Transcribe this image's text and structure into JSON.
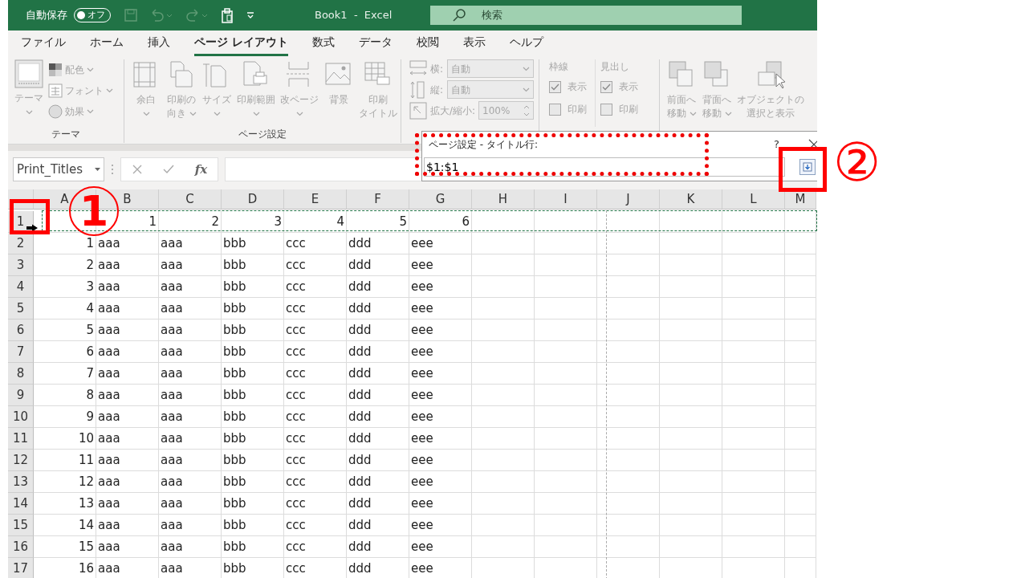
{
  "window": {
    "autosave": {
      "label": "自動保存",
      "toggle_text": "オフ",
      "on": false
    },
    "title": "Book1  -  Excel",
    "search": {
      "placeholder": "検索"
    }
  },
  "tabs": [
    {
      "label": "ファイル",
      "selected": false
    },
    {
      "label": "ホーム",
      "selected": false
    },
    {
      "label": "挿入",
      "selected": false
    },
    {
      "label": "ページ レイアウト",
      "selected": true
    },
    {
      "label": "数式",
      "selected": false
    },
    {
      "label": "データ",
      "selected": false
    },
    {
      "label": "校閲",
      "selected": false
    },
    {
      "label": "表示",
      "selected": false
    },
    {
      "label": "ヘルプ",
      "selected": false
    }
  ],
  "ribbon": {
    "disabled": true,
    "groups": [
      {
        "kind": "theme",
        "label": "テーマ",
        "big": "テーマ",
        "items": [
          "配色",
          "フォント",
          "効果"
        ]
      },
      {
        "kind": "buttons",
        "label": "ページ設定",
        "buttons": [
          {
            "lines": [
              "余白"
            ],
            "dropdown": true
          },
          {
            "lines": [
              "印刷の",
              "向き"
            ],
            "dropdown": true
          },
          {
            "lines": [
              "サイズ"
            ],
            "dropdown": true
          },
          {
            "lines": [
              "印刷範囲"
            ],
            "dropdown": true
          },
          {
            "lines": [
              "改ページ"
            ],
            "dropdown": true
          },
          {
            "lines": [
              "背景"
            ],
            "dropdown": false
          },
          {
            "lines": [
              "印刷",
              "タイトル"
            ],
            "dropdown": false
          }
        ]
      },
      {
        "kind": "scale",
        "rows": [
          {
            "label": "横:",
            "value": "自動",
            "kind": "dropdown"
          },
          {
            "label": "縦:",
            "value": "自動",
            "kind": "dropdown"
          },
          {
            "label": "拡大/縮小:",
            "value": "100%",
            "kind": "spin"
          }
        ]
      },
      {
        "kind": "sheet_options",
        "sections": [
          {
            "title": "枠線",
            "options": [
              {
                "label": "表示",
                "checked": true
              },
              {
                "label": "印刷",
                "checked": false
              }
            ]
          },
          {
            "title": "見出し",
            "options": [
              {
                "label": "表示",
                "checked": true
              },
              {
                "label": "印刷",
                "checked": false
              }
            ]
          }
        ]
      },
      {
        "kind": "buttons",
        "buttons": [
          {
            "lines": [
              "前面へ",
              "移動"
            ],
            "dropdown": true
          },
          {
            "lines": [
              "背面へ",
              "移動"
            ],
            "dropdown": true
          },
          {
            "lines": [
              "オブジェクトの",
              "選択と表示"
            ],
            "dropdown": false
          }
        ]
      }
    ]
  },
  "formula_bar": {
    "name_box": "Print_Titles",
    "fx": "fx"
  },
  "dialog": {
    "title": "ページ設定 - タイトル行:",
    "help": "?",
    "value": "$1:$1"
  },
  "sheet": {
    "columns": [
      "A",
      "B",
      "C",
      "D",
      "E",
      "F",
      "G",
      "H",
      "I",
      "J",
      "K",
      "L",
      "M"
    ],
    "rows": [
      {
        "header": "1",
        "kind": "numbers",
        "marquee": true,
        "cells": [
          "1",
          "2",
          "3",
          "4",
          "5",
          "6"
        ]
      },
      {
        "header": "2",
        "kind": "record",
        "cells": [
          "1",
          "aaa",
          "aaa",
          "bbb",
          "ccc",
          "ddd",
          "eee"
        ]
      },
      {
        "header": "3",
        "kind": "record",
        "cells": [
          "2",
          "aaa",
          "aaa",
          "bbb",
          "ccc",
          "ddd",
          "eee"
        ]
      },
      {
        "header": "4",
        "kind": "record",
        "cells": [
          "3",
          "aaa",
          "aaa",
          "bbb",
          "ccc",
          "ddd",
          "eee"
        ]
      },
      {
        "header": "5",
        "kind": "record",
        "cells": [
          "4",
          "aaa",
          "aaa",
          "bbb",
          "ccc",
          "ddd",
          "eee"
        ]
      },
      {
        "header": "6",
        "kind": "record",
        "cells": [
          "5",
          "aaa",
          "aaa",
          "bbb",
          "ccc",
          "ddd",
          "eee"
        ]
      },
      {
        "header": "7",
        "kind": "record",
        "cells": [
          "6",
          "aaa",
          "aaa",
          "bbb",
          "ccc",
          "ddd",
          "eee"
        ]
      },
      {
        "header": "8",
        "kind": "record",
        "cells": [
          "7",
          "aaa",
          "aaa",
          "bbb",
          "ccc",
          "ddd",
          "eee"
        ]
      },
      {
        "header": "9",
        "kind": "record",
        "cells": [
          "8",
          "aaa",
          "aaa",
          "bbb",
          "ccc",
          "ddd",
          "eee"
        ]
      },
      {
        "header": "10",
        "kind": "record",
        "cells": [
          "9",
          "aaa",
          "aaa",
          "bbb",
          "ccc",
          "ddd",
          "eee"
        ]
      },
      {
        "header": "11",
        "kind": "record",
        "cells": [
          "10",
          "aaa",
          "aaa",
          "bbb",
          "ccc",
          "ddd",
          "eee"
        ]
      },
      {
        "header": "12",
        "kind": "record",
        "cells": [
          "11",
          "aaa",
          "aaa",
          "bbb",
          "ccc",
          "ddd",
          "eee"
        ]
      },
      {
        "header": "13",
        "kind": "record",
        "cells": [
          "12",
          "aaa",
          "aaa",
          "bbb",
          "ccc",
          "ddd",
          "eee"
        ]
      },
      {
        "header": "14",
        "kind": "record",
        "cells": [
          "13",
          "aaa",
          "aaa",
          "bbb",
          "ccc",
          "ddd",
          "eee"
        ]
      },
      {
        "header": "15",
        "kind": "record",
        "cells": [
          "14",
          "aaa",
          "aaa",
          "bbb",
          "ccc",
          "ddd",
          "eee"
        ]
      },
      {
        "header": "16",
        "kind": "record",
        "cells": [
          "15",
          "aaa",
          "aaa",
          "bbb",
          "ccc",
          "ddd",
          "eee"
        ]
      },
      {
        "header": "17",
        "kind": "record",
        "cells": [
          "16",
          "aaa",
          "aaa",
          "bbb",
          "ccc",
          "ddd",
          "eee"
        ]
      }
    ]
  },
  "annotations": [
    {
      "kind": "frame"
    },
    {
      "kind": "circled",
      "text": "1"
    },
    {
      "kind": "dotted_frame"
    },
    {
      "kind": "frame"
    },
    {
      "kind": "glyph",
      "text": "②"
    }
  ]
}
